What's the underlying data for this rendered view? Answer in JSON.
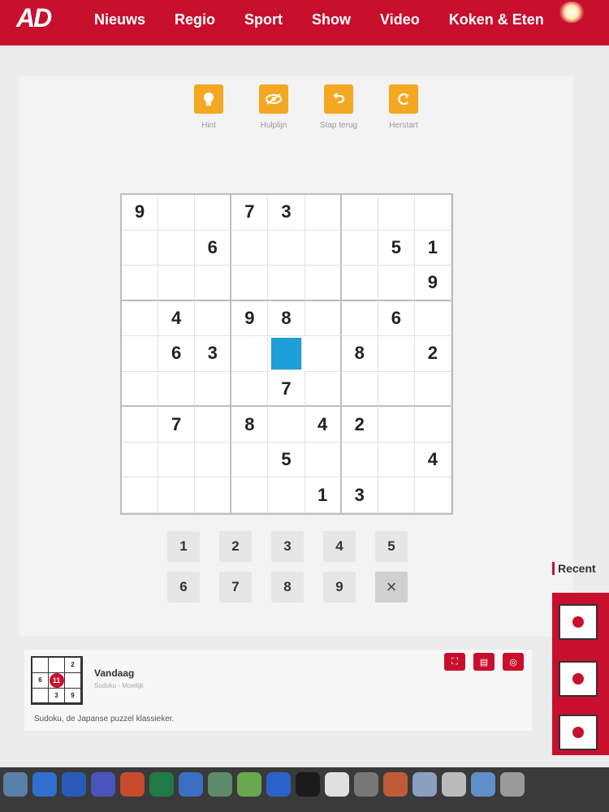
{
  "header": {
    "logo": "AD",
    "nav": [
      "Nieuws",
      "Regio",
      "Sport",
      "Show",
      "Video",
      "Koken & Eten"
    ],
    "brand_color": "#c8102e"
  },
  "toolbar": {
    "items": [
      {
        "label": "Hint",
        "icon": "lightbulb-icon"
      },
      {
        "label": "Hulplijn",
        "icon": "eye-off-icon"
      },
      {
        "label": "Stap terug",
        "icon": "undo-icon"
      },
      {
        "label": "Herstart",
        "icon": "restart-icon"
      }
    ],
    "accent": "#f4a821"
  },
  "board": {
    "rows": [
      [
        "9",
        "",
        "",
        "7",
        "3",
        "",
        "",
        "",
        ""
      ],
      [
        "",
        "",
        "6",
        "",
        "",
        "",
        "",
        "5",
        "1"
      ],
      [
        "",
        "",
        "",
        "",
        "",
        "",
        "",
        "",
        "9"
      ],
      [
        "",
        "4",
        "",
        "9",
        "8",
        "",
        "",
        "6",
        ""
      ],
      [
        "",
        "6",
        "3",
        "",
        "",
        "",
        "8",
        "",
        "2"
      ],
      [
        "",
        "",
        "",
        "",
        "7",
        "",
        "",
        "",
        ""
      ],
      [
        "",
        "7",
        "",
        "8",
        "",
        "4",
        "2",
        "",
        ""
      ],
      [
        "",
        "",
        "",
        "",
        "5",
        "",
        "",
        "",
        "4"
      ],
      [
        "",
        "",
        "",
        "",
        "",
        "1",
        "3",
        "",
        ""
      ]
    ],
    "selected": {
      "row": 4,
      "col": 4
    },
    "selected_color": "#1e9fd8"
  },
  "keypad": {
    "keys": [
      "1",
      "2",
      "3",
      "4",
      "5",
      "6",
      "7",
      "8",
      "9",
      "×"
    ]
  },
  "card": {
    "title": "Vandaag",
    "subtitle": "Sudoku - Moeilijk",
    "description": "Sudoku, de Japanse puzzel klassieker.",
    "thumb": {
      "center": "11",
      "top_right": "2",
      "mid_left": "6",
      "bottom_mid": "3",
      "bottom_right": "9"
    }
  },
  "recent": {
    "label": "Recent"
  }
}
